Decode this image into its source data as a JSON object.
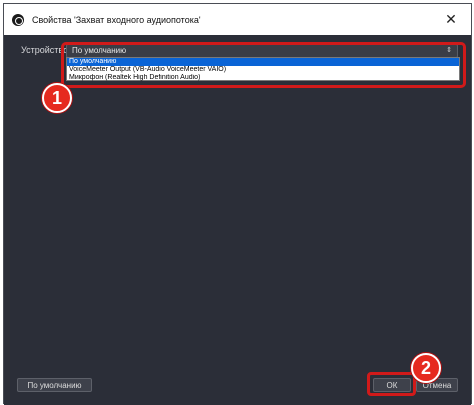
{
  "window": {
    "title": "Свойства 'Захват входного аудиопотока'",
    "close_glyph": "✕"
  },
  "device": {
    "label": "Устройство",
    "selected_value": "По умолчанию",
    "arrow_glyph": "⇕",
    "options": [
      "По умолчанию",
      "VoiceMeeter Output (VB-Audio VoiceMeeter VAIO)",
      "Микрофон (Realtek High Definition Audio)"
    ]
  },
  "buttons": {
    "defaults_label": "По умолчанию",
    "ok_label": "ОК",
    "cancel_label": "Отмена"
  },
  "callouts": {
    "step1": "1",
    "step2": "2"
  },
  "colors": {
    "dialog_background": "#2b2e38",
    "highlight": "#d11a1a",
    "selection": "#0a64d6"
  }
}
